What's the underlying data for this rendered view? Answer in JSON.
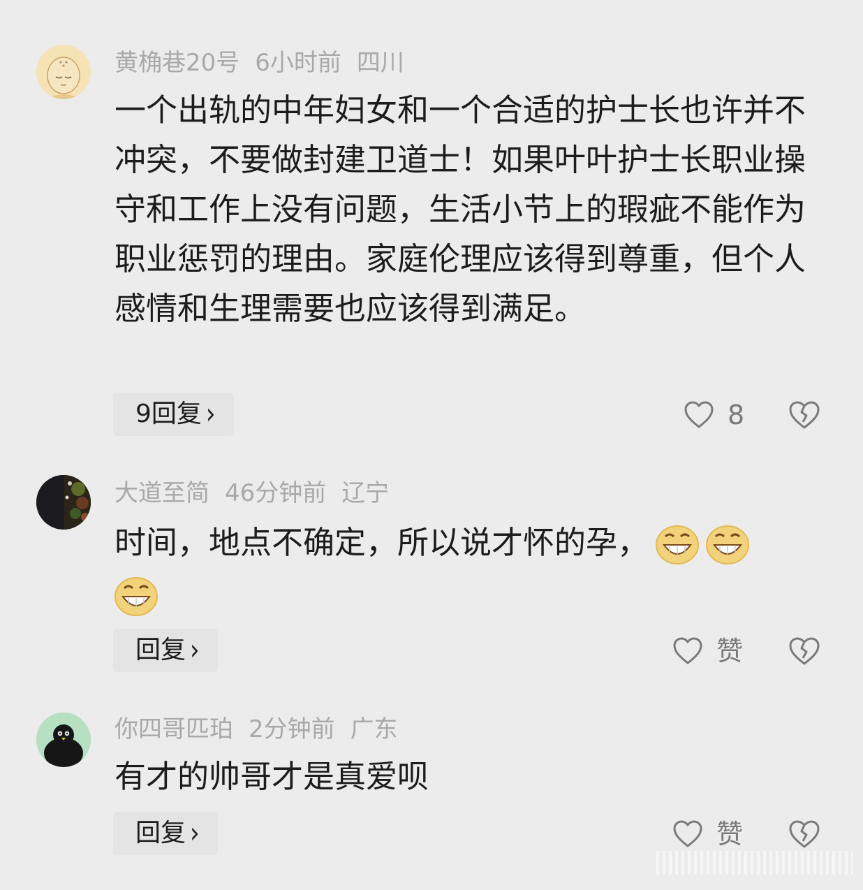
{
  "comments": [
    {
      "username": "黄桷巷20号",
      "time": "6小时前",
      "location": "四川",
      "text": "一个出轨的中年妇女和一个合适的护士长也许并不冲突，不要做封建卫道士！如果叶叶护士长职业操守和工作上没有问题，生活小节上的瑕疵不能作为职业惩罚的理由。家庭伦理应该得到尊重，但个人感情和生理需要也应该得到满足。",
      "reply_label": "9回复",
      "like_label": "8"
    },
    {
      "username": "大道至简",
      "time": "46分钟前",
      "location": "辽宁",
      "text": "时间，地点不确定，所以说才怀的孕，",
      "emojis": [
        "grin-emoji",
        "grin-emoji",
        "grin-emoji"
      ],
      "reply_label": "回复",
      "like_label": "赞"
    },
    {
      "username": "你四哥匹珀",
      "time": "2分钟前",
      "location": "广东",
      "text": "有才的帅哥才是真爱呗",
      "reply_label": "回复",
      "like_label": "赞"
    }
  ],
  "icons": {
    "like": "heart-outline-icon",
    "dislike": "broken-heart-icon",
    "reply_chevron": "chevron-right-icon"
  },
  "colors": {
    "background": "#ececec",
    "meta_text": "#a9a9a9",
    "body_text": "#1c1c1c",
    "icon": "#7a7a7a"
  }
}
